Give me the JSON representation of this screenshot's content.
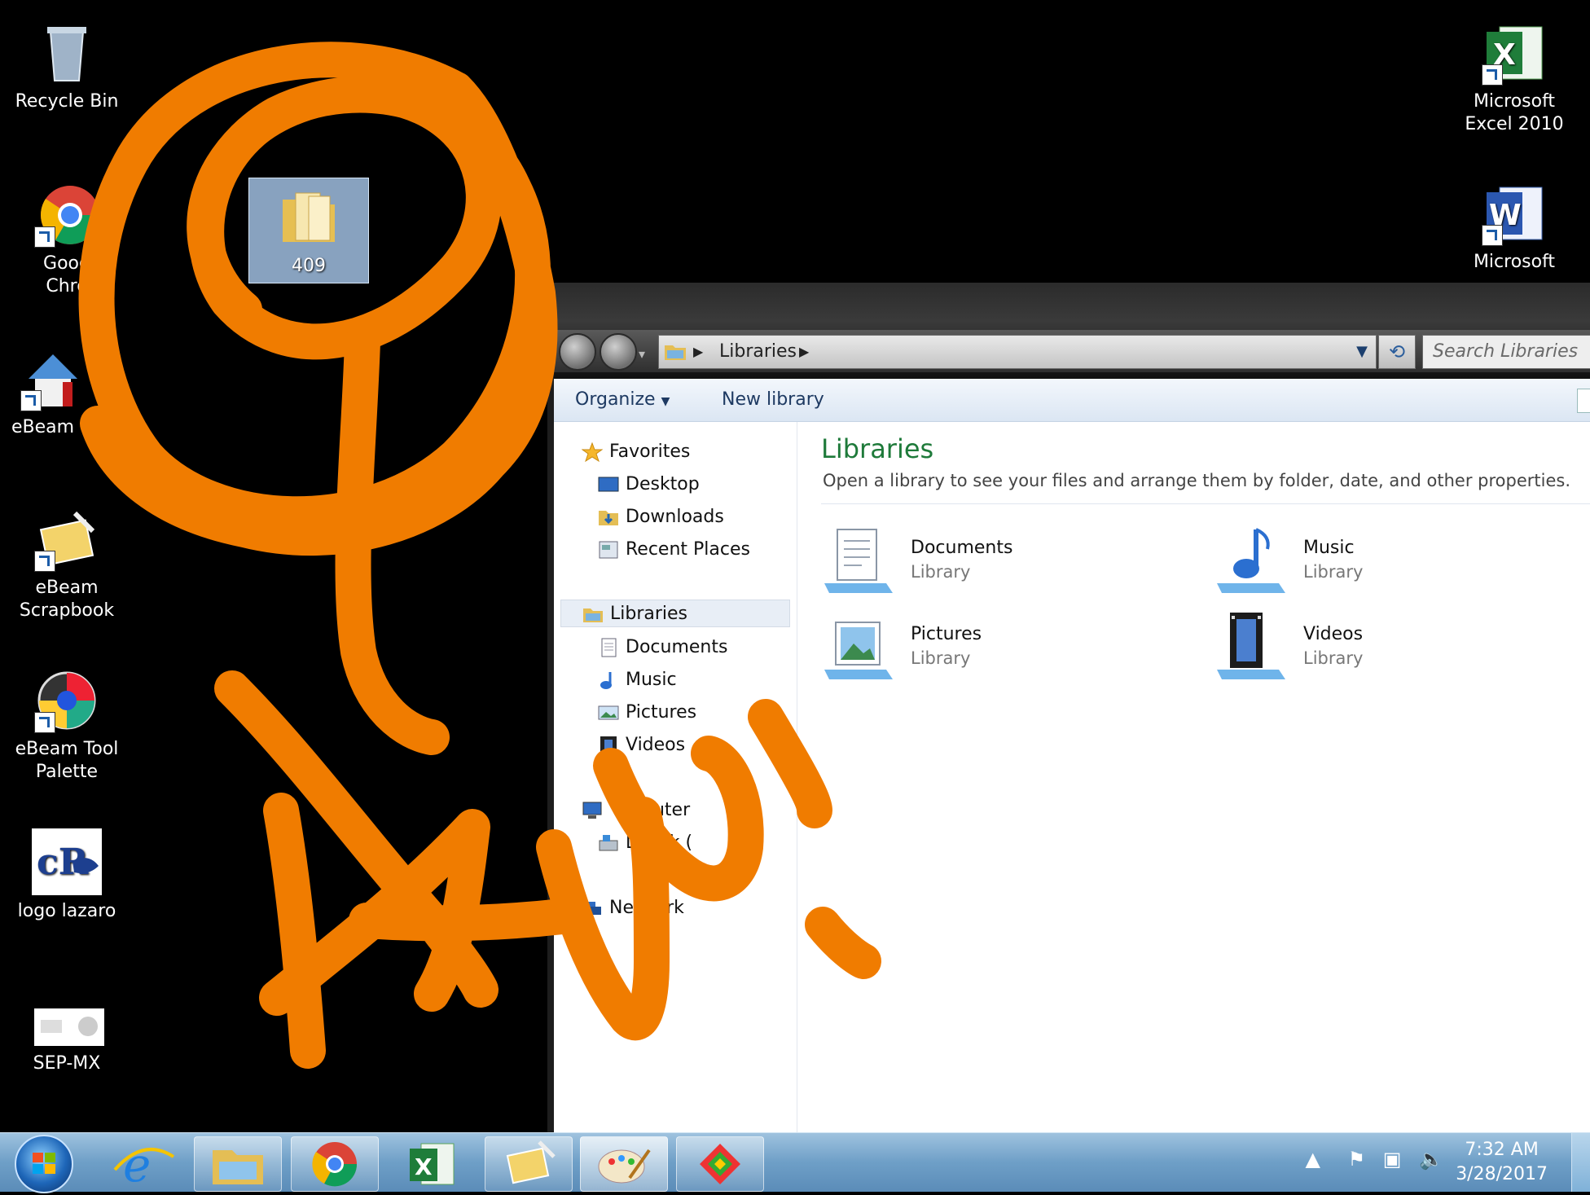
{
  "desktop": {
    "icons": [
      {
        "label": "Recycle Bin"
      },
      {
        "label": "Goog"
      },
      {
        "label": "Chro"
      },
      {
        "label": "eBeam"
      },
      {
        "label": "eBeam\nScrapbook"
      },
      {
        "label": "eBeam Tool\nPalette"
      },
      {
        "label": "logo lazaro"
      },
      {
        "label": "SEP-MX"
      },
      {
        "label": "409"
      },
      {
        "label": "Microsoft\nExcel 2010"
      },
      {
        "label": "Microsoft"
      }
    ]
  },
  "explorer": {
    "address": {
      "crumb": "Libraries"
    },
    "search": {
      "placeholder": "Search Libraries"
    },
    "toolbar": {
      "organize": "Organize",
      "new_library": "New library"
    },
    "nav": {
      "favorites": "Favorites",
      "desktop": "Desktop",
      "downloads": "Downloads",
      "recent": "Recent Places",
      "libraries": "Libraries",
      "documents": "Documents",
      "music": "Music",
      "pictures": "Pictures",
      "videos": "Videos",
      "computer": "puter",
      "disk": "L   Disk (",
      "network": "Network"
    },
    "main": {
      "title": "Libraries",
      "subtitle": "Open a library to see your files and arrange them by folder, date, and other properties.",
      "tiles": [
        {
          "name": "Documents",
          "type": "Library"
        },
        {
          "name": "Music",
          "type": "Library"
        },
        {
          "name": "Pictures",
          "type": "Library"
        },
        {
          "name": "Videos",
          "type": "Library"
        }
      ]
    }
  },
  "taskbar": {
    "time": "7:32 AM",
    "date": "3/28/2017"
  },
  "colors": {
    "doodle": "#f07c00",
    "title_green": "#1e7a3a"
  }
}
